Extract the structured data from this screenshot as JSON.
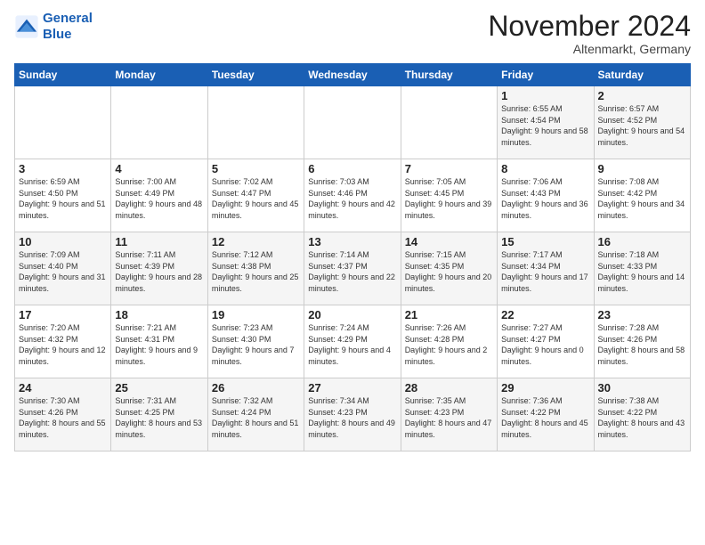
{
  "logo": {
    "line1": "General",
    "line2": "Blue"
  },
  "title": "November 2024",
  "location": "Altenmarkt, Germany",
  "days_header": [
    "Sunday",
    "Monday",
    "Tuesday",
    "Wednesday",
    "Thursday",
    "Friday",
    "Saturday"
  ],
  "weeks": [
    [
      {
        "day": "",
        "info": ""
      },
      {
        "day": "",
        "info": ""
      },
      {
        "day": "",
        "info": ""
      },
      {
        "day": "",
        "info": ""
      },
      {
        "day": "",
        "info": ""
      },
      {
        "day": "1",
        "info": "Sunrise: 6:55 AM\nSunset: 4:54 PM\nDaylight: 9 hours and 58 minutes."
      },
      {
        "day": "2",
        "info": "Sunrise: 6:57 AM\nSunset: 4:52 PM\nDaylight: 9 hours and 54 minutes."
      }
    ],
    [
      {
        "day": "3",
        "info": "Sunrise: 6:59 AM\nSunset: 4:50 PM\nDaylight: 9 hours and 51 minutes."
      },
      {
        "day": "4",
        "info": "Sunrise: 7:00 AM\nSunset: 4:49 PM\nDaylight: 9 hours and 48 minutes."
      },
      {
        "day": "5",
        "info": "Sunrise: 7:02 AM\nSunset: 4:47 PM\nDaylight: 9 hours and 45 minutes."
      },
      {
        "day": "6",
        "info": "Sunrise: 7:03 AM\nSunset: 4:46 PM\nDaylight: 9 hours and 42 minutes."
      },
      {
        "day": "7",
        "info": "Sunrise: 7:05 AM\nSunset: 4:45 PM\nDaylight: 9 hours and 39 minutes."
      },
      {
        "day": "8",
        "info": "Sunrise: 7:06 AM\nSunset: 4:43 PM\nDaylight: 9 hours and 36 minutes."
      },
      {
        "day": "9",
        "info": "Sunrise: 7:08 AM\nSunset: 4:42 PM\nDaylight: 9 hours and 34 minutes."
      }
    ],
    [
      {
        "day": "10",
        "info": "Sunrise: 7:09 AM\nSunset: 4:40 PM\nDaylight: 9 hours and 31 minutes."
      },
      {
        "day": "11",
        "info": "Sunrise: 7:11 AM\nSunset: 4:39 PM\nDaylight: 9 hours and 28 minutes."
      },
      {
        "day": "12",
        "info": "Sunrise: 7:12 AM\nSunset: 4:38 PM\nDaylight: 9 hours and 25 minutes."
      },
      {
        "day": "13",
        "info": "Sunrise: 7:14 AM\nSunset: 4:37 PM\nDaylight: 9 hours and 22 minutes."
      },
      {
        "day": "14",
        "info": "Sunrise: 7:15 AM\nSunset: 4:35 PM\nDaylight: 9 hours and 20 minutes."
      },
      {
        "day": "15",
        "info": "Sunrise: 7:17 AM\nSunset: 4:34 PM\nDaylight: 9 hours and 17 minutes."
      },
      {
        "day": "16",
        "info": "Sunrise: 7:18 AM\nSunset: 4:33 PM\nDaylight: 9 hours and 14 minutes."
      }
    ],
    [
      {
        "day": "17",
        "info": "Sunrise: 7:20 AM\nSunset: 4:32 PM\nDaylight: 9 hours and 12 minutes."
      },
      {
        "day": "18",
        "info": "Sunrise: 7:21 AM\nSunset: 4:31 PM\nDaylight: 9 hours and 9 minutes."
      },
      {
        "day": "19",
        "info": "Sunrise: 7:23 AM\nSunset: 4:30 PM\nDaylight: 9 hours and 7 minutes."
      },
      {
        "day": "20",
        "info": "Sunrise: 7:24 AM\nSunset: 4:29 PM\nDaylight: 9 hours and 4 minutes."
      },
      {
        "day": "21",
        "info": "Sunrise: 7:26 AM\nSunset: 4:28 PM\nDaylight: 9 hours and 2 minutes."
      },
      {
        "day": "22",
        "info": "Sunrise: 7:27 AM\nSunset: 4:27 PM\nDaylight: 9 hours and 0 minutes."
      },
      {
        "day": "23",
        "info": "Sunrise: 7:28 AM\nSunset: 4:26 PM\nDaylight: 8 hours and 58 minutes."
      }
    ],
    [
      {
        "day": "24",
        "info": "Sunrise: 7:30 AM\nSunset: 4:26 PM\nDaylight: 8 hours and 55 minutes."
      },
      {
        "day": "25",
        "info": "Sunrise: 7:31 AM\nSunset: 4:25 PM\nDaylight: 8 hours and 53 minutes."
      },
      {
        "day": "26",
        "info": "Sunrise: 7:32 AM\nSunset: 4:24 PM\nDaylight: 8 hours and 51 minutes."
      },
      {
        "day": "27",
        "info": "Sunrise: 7:34 AM\nSunset: 4:23 PM\nDaylight: 8 hours and 49 minutes."
      },
      {
        "day": "28",
        "info": "Sunrise: 7:35 AM\nSunset: 4:23 PM\nDaylight: 8 hours and 47 minutes."
      },
      {
        "day": "29",
        "info": "Sunrise: 7:36 AM\nSunset: 4:22 PM\nDaylight: 8 hours and 45 minutes."
      },
      {
        "day": "30",
        "info": "Sunrise: 7:38 AM\nSunset: 4:22 PM\nDaylight: 8 hours and 43 minutes."
      }
    ]
  ]
}
